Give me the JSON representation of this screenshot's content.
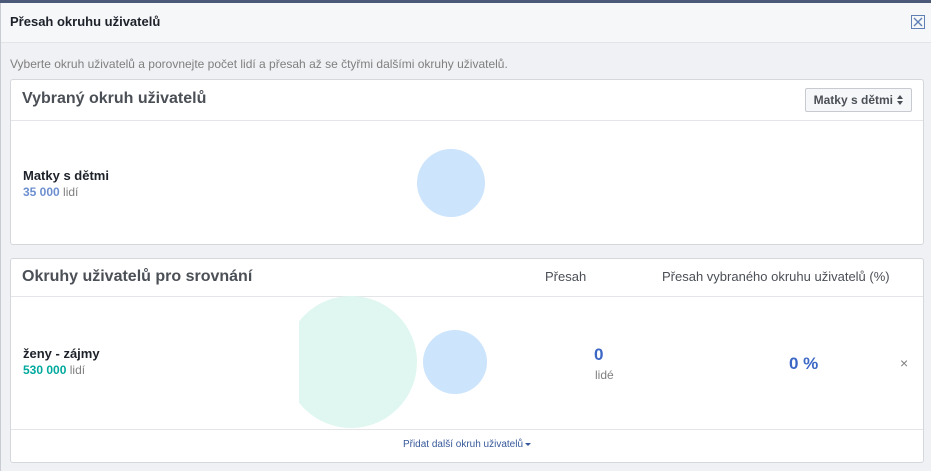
{
  "dialog": {
    "title": "Přesah okruhu uživatelů",
    "description": "Vyberte okruh uživatelů a porovnejte počet lidí a přesah až se čtyřmi dalšími okruhy uživatelů."
  },
  "selected": {
    "section_title": "Vybraný okruh uživatelů",
    "dropdown_value": "Matky s dětmi",
    "audience": {
      "name": "Matky s dětmi",
      "count": "35 000",
      "unit": "lidí"
    }
  },
  "comparison": {
    "section_title": "Okruhy uživatelů pro srovnání",
    "col_overlap": "Přesah",
    "col_percent": "Přesah vybraného okruhu uživatelů (%)",
    "rows": [
      {
        "name": "ženy - zájmy",
        "count": "530 000",
        "unit": "lidí",
        "overlap": "0",
        "overlap_unit": "lidé",
        "percent": "0 %",
        "remove": "×"
      }
    ],
    "add_link": "Přidat další okruh uživatelů"
  },
  "colors": {
    "selected_count": "#6d8fd0",
    "compare_count": "#00a99d",
    "selected_circle": "#cce4fc",
    "compare_circle": "#dff7f0",
    "accent": "#3b67c5"
  }
}
